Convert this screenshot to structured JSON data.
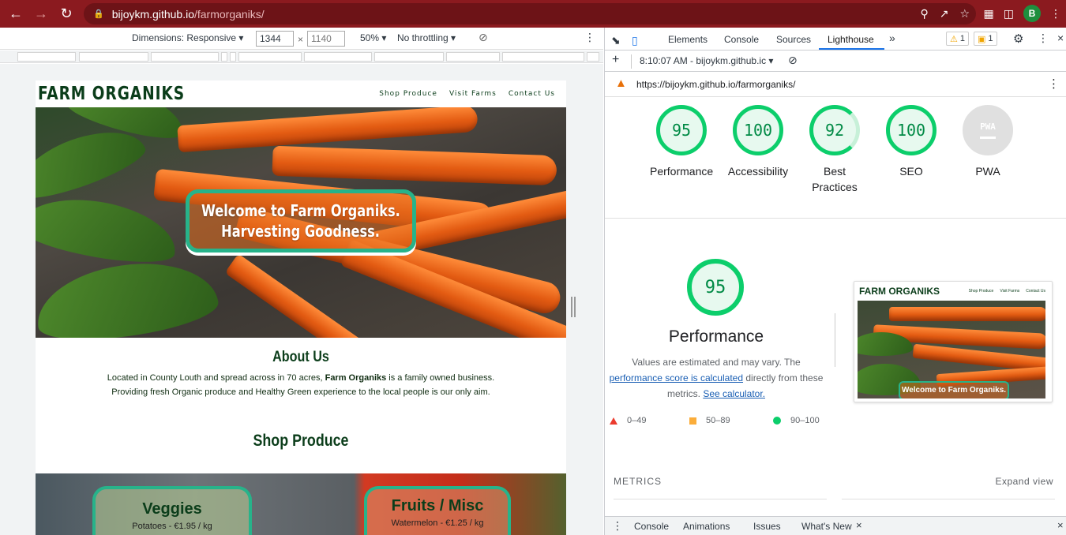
{
  "browser": {
    "url_host": "bijoykm.github.io",
    "url_path": "/farmorganiks/",
    "profile_initial": "B"
  },
  "device_toolbar": {
    "dimensions_label": "Dimensions: Responsive",
    "width": "1344",
    "height": "1140",
    "zoom": "50%",
    "throttling": "No throttling"
  },
  "site": {
    "logo": "FARM ORGANIKS",
    "nav": [
      "Shop Produce",
      "Visit Farms",
      "Contact Us"
    ],
    "hero_line1": "Welcome to Farm Organiks.",
    "hero_line2": "Harvesting Goodness.",
    "about_title": "About Us",
    "about_text_pre": "Located in County Louth and spread across in 70 acres, ",
    "about_text_brand": "Farm Organiks",
    "about_text_post": " is a family owned business.",
    "about_text_line2": "Providing fresh Organic produce and Healthy Green experience to the local people is our only aim.",
    "shop_title": "Shop Produce",
    "cards": [
      {
        "title": "Veggies",
        "sub": "Potatoes - €1.95 / kg"
      },
      {
        "title": "Fruits / Misc",
        "sub": "Watermelon - €1.25 / kg"
      }
    ]
  },
  "devtools": {
    "tabs": [
      "Elements",
      "Console",
      "Sources",
      "Lighthouse"
    ],
    "warning_count": "1",
    "issue_count": "1",
    "report_time": "8:10:07 AM - bijoykm.github.ic",
    "report_url": "https://bijoykm.github.io/farmorganiks/",
    "scores": [
      {
        "label": "Performance",
        "value": "95"
      },
      {
        "label": "Accessibility",
        "value": "100"
      },
      {
        "label": "Best Practices",
        "value": "92"
      },
      {
        "label": "SEO",
        "value": "100"
      },
      {
        "label": "PWA",
        "value": "PWA"
      }
    ],
    "perf_score": "95",
    "perf_title": "Performance",
    "perf_desc_1": "Values are estimated and may vary. The",
    "perf_link_1": "performance score is calculated",
    "perf_desc_2": " directly from these",
    "perf_desc_3": "metrics. ",
    "perf_link_2": "See calculator.",
    "thumb_logo": "FARM ORGANIKS",
    "thumb_nav": [
      "Shop Produce",
      "Visit Farms",
      "Contact Us"
    ],
    "thumb_banner": "Welcome to Farm Organiks.",
    "legend": [
      "0–49",
      "50–89",
      "90–100"
    ],
    "metrics_header": "METRICS",
    "expand_view": "Expand view",
    "drawer_tabs": [
      "Console",
      "Animations",
      "Issues",
      "What's New"
    ]
  },
  "colors": {
    "browser_frame": "#8b1a1f",
    "score_green": "#0cce6b",
    "brand_green": "#0b3d1a",
    "banner_border": "#27b38a"
  }
}
